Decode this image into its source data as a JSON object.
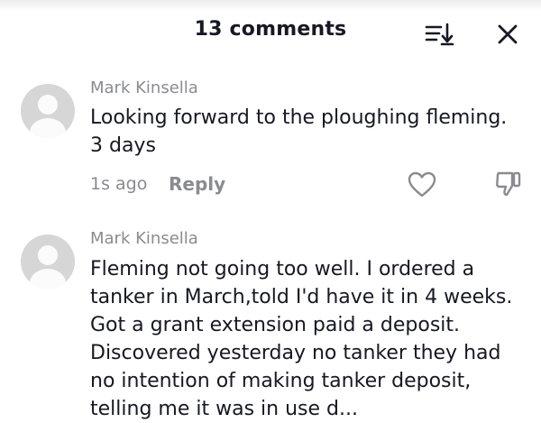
{
  "header": {
    "title": "13 comments"
  },
  "icons": {
    "sort": "sort-icon",
    "close": "close-icon",
    "like": "heart-icon",
    "dislike": "thumbs-down-icon",
    "avatar": "default-avatar-icon"
  },
  "comments": [
    {
      "username": "Mark Kinsella",
      "text": "Looking forward to the ploughing fleming. 3 days",
      "time": "1s ago",
      "reply_label": "Reply"
    },
    {
      "username": "Mark Kinsella",
      "text": "Fleming not going too well. I ordered a tanker in March,told I'd have it in 4 weeks. Got a grant extension paid a deposit. Discovered yesterday no tanker they had no intention of making tanker deposit, telling me it was in use d..."
    }
  ],
  "colors": {
    "text_primary": "#161823",
    "text_secondary": "#8a8b91",
    "avatar_bg": "#d6d6d6"
  }
}
